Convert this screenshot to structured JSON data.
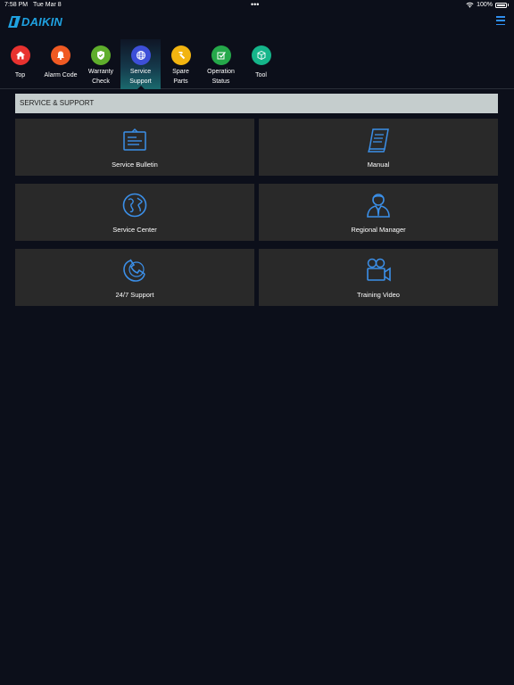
{
  "status_bar": {
    "time": "7:58 PM",
    "date": "Tue Mar 8",
    "dots": "•••",
    "battery": "100%"
  },
  "header": {
    "logo_text": "DAIKIN"
  },
  "nav": {
    "items": [
      {
        "label_line1": "Top",
        "label_line2": "",
        "icon": "home-icon",
        "color": "#e8322f"
      },
      {
        "label_line1": "Alarm Code",
        "label_line2": "",
        "icon": "bell-icon",
        "color": "#f05a23"
      },
      {
        "label_line1": "Warranty",
        "label_line2": "Check",
        "icon": "shield-icon",
        "color": "#5fae2c"
      },
      {
        "label_line1": "Service",
        "label_line2": "Support",
        "icon": "globe-icon",
        "color": "#3d4fd8"
      },
      {
        "label_line1": "Spare",
        "label_line2": "Parts",
        "icon": "hammer-icon",
        "color": "#f2b410"
      },
      {
        "label_line1": "Operation",
        "label_line2": "Status",
        "icon": "checkbox-icon",
        "color": "#25a84a"
      },
      {
        "label_line1": "Tool",
        "label_line2": "",
        "icon": "cube-icon",
        "color": "#15b58a"
      }
    ],
    "active": "Service Support"
  },
  "section": {
    "title": "SERVICE & SUPPORT"
  },
  "tiles": [
    {
      "label": "Service Bulletin",
      "icon": "bulletin-board-icon"
    },
    {
      "label": "Manual",
      "icon": "manual-book-icon"
    },
    {
      "label": "Service Center",
      "icon": "globe-icon"
    },
    {
      "label": "Regional Manager",
      "icon": "manager-person-icon"
    },
    {
      "label": "24/7 Support",
      "icon": "phone-support-icon"
    },
    {
      "label": "Training Video",
      "icon": "video-camera-icon"
    }
  ],
  "colors": {
    "accent": "#3b8fe8",
    "background": "#0c0f1a",
    "tile": "#292929",
    "section_header": "#c5cdcd"
  }
}
